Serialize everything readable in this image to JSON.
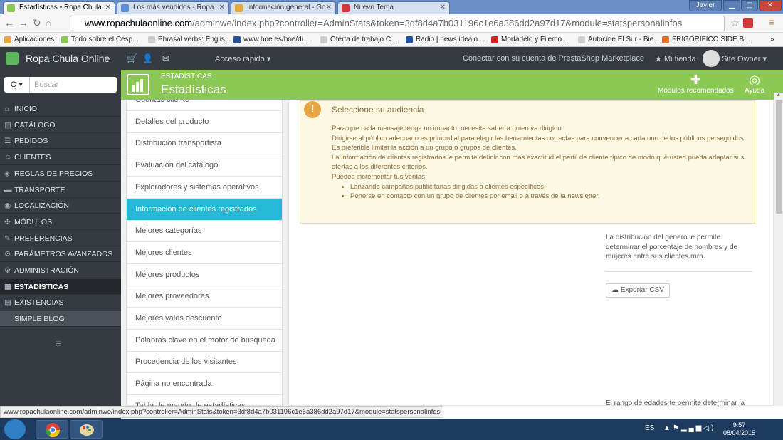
{
  "browser": {
    "tabs": [
      {
        "title": "Estadísticas • Ropa Chula",
        "active": true,
        "color": "#8bc954"
      },
      {
        "title": "Los más vendidos - Ropa",
        "active": false,
        "color": "#5b8fd6"
      },
      {
        "title": "Información general - Go",
        "active": false,
        "color": "#e8a543"
      },
      {
        "title": "Nuevo Tema",
        "active": false,
        "color": "#d03a3a"
      }
    ],
    "window_user": "Javier",
    "url_host": "www.ropachulaonline.com",
    "url_rest": "/adminwe/index.php?controller=AdminStats&token=3df8d4a7b031196c1e6a386dd2a97d17&module=statspersonalinfos",
    "bookmarks": [
      "Aplicaciones",
      "Todo sobre el Cesp...",
      "Phrasal verbs: Englis...",
      "www.boe.es/boe/di...",
      "Oferta de trabajo C...",
      "Radio | news.idealo....",
      "Mortadelo y Filemo...",
      "Autocine El Sur - Bie...",
      "FRIGORIFICO SIDE B..."
    ],
    "status_url": "www.ropachulaonline.com/adminwe/index.php?controller=AdminStats&token=3df8d4a7b031196c1e6a386dd2a97d17&module=statspersonalinfos"
  },
  "admin": {
    "shop_name": "Ropa Chula Online",
    "quick_access": "Acceso rápido ▾",
    "connect": "Conectar con su cuenta de PrestaShop Marketplace",
    "my_shop": "Mi tienda",
    "owner": "Site Owner ▾",
    "search_button": "Q ▾",
    "search_placeholder": "Buscar"
  },
  "sidebar": {
    "items": [
      {
        "label": "INICIO",
        "icon": "⌂"
      },
      {
        "label": "CATÁLOGO",
        "icon": "▤"
      },
      {
        "label": "PEDIDOS",
        "icon": "☰"
      },
      {
        "label": "CLIENTES",
        "icon": "☺"
      },
      {
        "label": "REGLAS DE PRECIOS",
        "icon": "◈"
      },
      {
        "label": "TRANSPORTE",
        "icon": "▬"
      },
      {
        "label": "LOCALIZACIÓN",
        "icon": "◉"
      },
      {
        "label": "MÓDULOS",
        "icon": "✣"
      },
      {
        "label": "PREFERENCIAS",
        "icon": "✎"
      },
      {
        "label": "PARÁMETROS AVANZADOS",
        "icon": "⚙"
      },
      {
        "label": "ADMINISTRACIÓN",
        "icon": "⚙"
      },
      {
        "label": "ESTADÍSTICAS",
        "icon": "▦"
      },
      {
        "label": "EXISTENCIAS",
        "icon": "▤"
      },
      {
        "label": "SIMPLE BLOG",
        "icon": ""
      }
    ],
    "active_index": 11,
    "collapse_icon": "≡"
  },
  "page": {
    "breadcrumb": "ESTADÍSTICAS",
    "title": "Estadísticas",
    "btn_modules": "Módulos recomendados",
    "btn_help": "Ayuda"
  },
  "modules": {
    "items": [
      "Cuentas cliente",
      "Detalles del producto",
      "Distribución transportista",
      "Evaluación del catálogo",
      "Exploradores y sistemas operativos",
      "Información de clientes registrados",
      "Mejores categorías",
      "Mejores clientes",
      "Mejores productos",
      "Mejores proveedores",
      "Mejores vales descuento",
      "Palabras clave en el motor de búsqueda",
      "Procedencia de los visitantes",
      "Página no encontrada",
      "Tabla de mando de estadísticas"
    ],
    "active_index": 5
  },
  "alert": {
    "title": "Seleccione su audiencia",
    "p1": "Para que cada mensaje tenga un impacto, necesita saber a quien va dirigido.",
    "p2": "Dirigirse al público adecuado es primordial para elegir las herramientas correctas para convencer a cada uno de los públicos perseguidos",
    "p3": "Es preferible limitar la acción a un grupo o grupos de clientes.",
    "p4": "La información de clientes registrados le permite definir con mas exactitud el perfil de cliente típico de modo que usted pueda adaptar sus ofertas a los diferentes criterios.",
    "p5": "Puedes incrementar tus ventas:",
    "b1": "Lanzando campañas publicitarias dirigidas a clientes específicos.",
    "b2": "Ponerse en contacto con un grupo de clientes por email o a través de la newsletter."
  },
  "stats": {
    "gender_text": "La distribución del género le permite determinar el porcentaje de hombres y de mujeres entre sus clientes.rnrn.",
    "export_label": "Exportar CSV",
    "age_text": "El rango de edades te permite determinar la edad media de tus clientes."
  },
  "taskbar": {
    "lang": "ES",
    "time": "9:57",
    "date": "08/04/2015"
  },
  "colors": {
    "green": "#8bc954",
    "active_module": "#25b9d7",
    "sidebar": "#363a41"
  }
}
